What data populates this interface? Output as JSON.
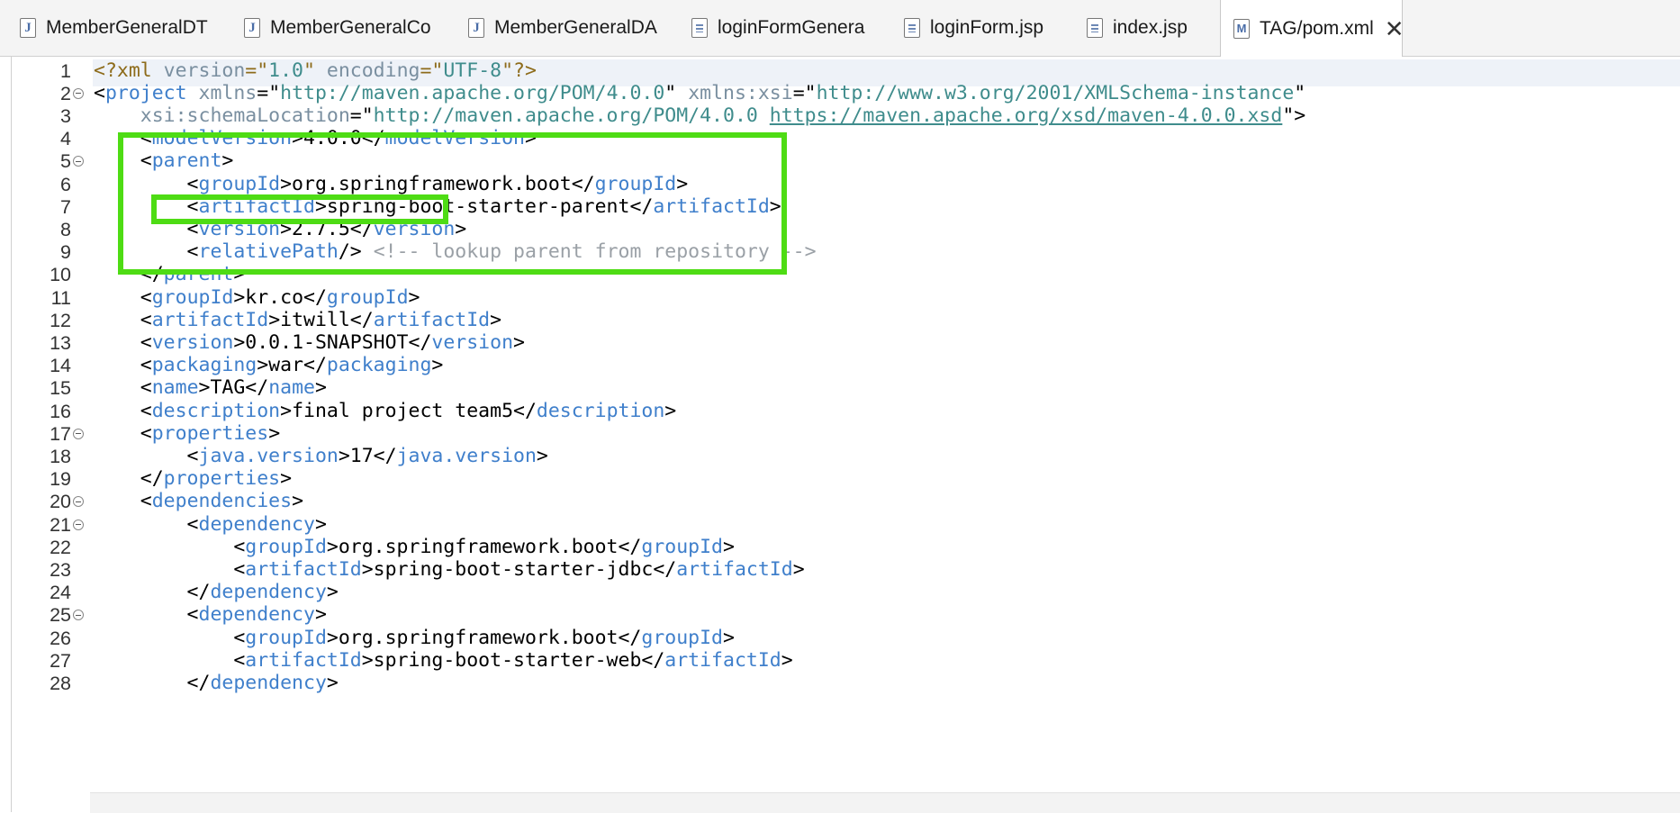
{
  "tabs": [
    {
      "label": "MemberGeneralDT",
      "icon": "java-file-icon"
    },
    {
      "label": "MemberGeneralCo",
      "icon": "java-file-icon"
    },
    {
      "label": "MemberGeneralDA",
      "icon": "java-file-icon"
    },
    {
      "label": "loginFormGenera",
      "icon": "jsp-file-icon"
    },
    {
      "label": "loginForm.jsp",
      "icon": "jsp-file-icon"
    },
    {
      "label": "index.jsp",
      "icon": "jsp-file-icon"
    },
    {
      "label": "TAG/pom.xml",
      "icon": "maven-xml-icon",
      "active": true
    }
  ],
  "editor": {
    "lines": [
      {
        "n": "1",
        "fold": false,
        "parts": [
          [
            "pi",
            "<?xml "
          ],
          [
            "attr",
            "version"
          ],
          [
            "pi",
            "=\""
          ],
          [
            "str",
            "1.0"
          ],
          [
            "pi",
            "\" "
          ],
          [
            "attr",
            "encoding"
          ],
          [
            "pi",
            "=\""
          ],
          [
            "str",
            "UTF-8"
          ],
          [
            "pi",
            "\"?>"
          ]
        ]
      },
      {
        "n": "2",
        "fold": true,
        "parts": [
          [
            "",
            "<"
          ],
          [
            "tag",
            "project"
          ],
          [
            "",
            " "
          ],
          [
            "attr",
            "xmlns"
          ],
          [
            "",
            "=\""
          ],
          [
            "str",
            "http://maven.apache.org/POM/4.0.0"
          ],
          [
            "",
            "\" "
          ],
          [
            "attr",
            "xmlns:xsi"
          ],
          [
            "",
            "=\""
          ],
          [
            "str",
            "http://www.w3.org/2001/XMLSchema-instance"
          ],
          [
            "",
            "\""
          ]
        ]
      },
      {
        "n": "3",
        "fold": false,
        "parts": [
          [
            "",
            "    "
          ],
          [
            "attr",
            "xsi:schemaLocation"
          ],
          [
            "",
            "=\""
          ],
          [
            "str",
            "http://maven.apache.org/POM/4.0.0 "
          ],
          [
            "link",
            "https://maven.apache.org/xsd/maven-4.0.0.xsd"
          ],
          [
            "",
            "\">"
          ]
        ]
      },
      {
        "n": "4",
        "fold": false,
        "parts": [
          [
            "",
            "    <"
          ],
          [
            "tag",
            "modelVersion"
          ],
          [
            "",
            ">4.0.0</"
          ],
          [
            "tag",
            "modelVersion"
          ],
          [
            "",
            ">"
          ]
        ]
      },
      {
        "n": "5",
        "fold": true,
        "parts": [
          [
            "",
            "    <"
          ],
          [
            "tag",
            "parent"
          ],
          [
            "",
            ">"
          ]
        ]
      },
      {
        "n": "6",
        "fold": false,
        "parts": [
          [
            "",
            "        <"
          ],
          [
            "tag",
            "groupId"
          ],
          [
            "",
            ">org.springframework.boot</"
          ],
          [
            "tag",
            "groupId"
          ],
          [
            "",
            ">"
          ]
        ]
      },
      {
        "n": "7",
        "fold": false,
        "parts": [
          [
            "",
            "        <"
          ],
          [
            "tag",
            "artifactId"
          ],
          [
            "",
            ">spring-boot-starter-parent</"
          ],
          [
            "tag",
            "artifactId"
          ],
          [
            "",
            ">"
          ]
        ]
      },
      {
        "n": "8",
        "fold": false,
        "parts": [
          [
            "",
            "        <"
          ],
          [
            "tag",
            "version"
          ],
          [
            "",
            ">2.7.5</"
          ],
          [
            "tag",
            "version"
          ],
          [
            "",
            ">"
          ]
        ]
      },
      {
        "n": "9",
        "fold": false,
        "parts": [
          [
            "",
            "        <"
          ],
          [
            "tag",
            "relativePath"
          ],
          [
            "",
            "/> "
          ],
          [
            "cmt",
            "<!-- lookup parent from repository -->"
          ]
        ]
      },
      {
        "n": "10",
        "fold": false,
        "parts": [
          [
            "",
            "    </"
          ],
          [
            "tag",
            "parent"
          ],
          [
            "",
            ">"
          ]
        ]
      },
      {
        "n": "11",
        "fold": false,
        "parts": [
          [
            "",
            "    <"
          ],
          [
            "tag",
            "groupId"
          ],
          [
            "",
            ">kr.co</"
          ],
          [
            "tag",
            "groupId"
          ],
          [
            "",
            ">"
          ]
        ]
      },
      {
        "n": "12",
        "fold": false,
        "parts": [
          [
            "",
            "    <"
          ],
          [
            "tag",
            "artifactId"
          ],
          [
            "",
            ">itwill</"
          ],
          [
            "tag",
            "artifactId"
          ],
          [
            "",
            ">"
          ]
        ]
      },
      {
        "n": "13",
        "fold": false,
        "parts": [
          [
            "",
            "    <"
          ],
          [
            "tag",
            "version"
          ],
          [
            "",
            ">0.0.1-SNAPSHOT</"
          ],
          [
            "tag",
            "version"
          ],
          [
            "",
            ">"
          ]
        ]
      },
      {
        "n": "14",
        "fold": false,
        "parts": [
          [
            "",
            "    <"
          ],
          [
            "tag",
            "packaging"
          ],
          [
            "",
            ">war</"
          ],
          [
            "tag",
            "packaging"
          ],
          [
            "",
            ">"
          ]
        ]
      },
      {
        "n": "15",
        "fold": false,
        "parts": [
          [
            "",
            "    <"
          ],
          [
            "tag",
            "name"
          ],
          [
            "",
            ">TAG</"
          ],
          [
            "tag",
            "name"
          ],
          [
            "",
            ">"
          ]
        ]
      },
      {
        "n": "16",
        "fold": false,
        "parts": [
          [
            "",
            "    <"
          ],
          [
            "tag",
            "description"
          ],
          [
            "",
            ">final project team5</"
          ],
          [
            "tag",
            "description"
          ],
          [
            "",
            ">"
          ]
        ]
      },
      {
        "n": "17",
        "fold": true,
        "parts": [
          [
            "",
            "    <"
          ],
          [
            "tag",
            "properties"
          ],
          [
            "",
            ">"
          ]
        ]
      },
      {
        "n": "18",
        "fold": false,
        "parts": [
          [
            "",
            "        <"
          ],
          [
            "tag",
            "java.version"
          ],
          [
            "",
            ">17</"
          ],
          [
            "tag",
            "java.version"
          ],
          [
            "",
            ">"
          ]
        ]
      },
      {
        "n": "19",
        "fold": false,
        "parts": [
          [
            "",
            "    </"
          ],
          [
            "tag",
            "properties"
          ],
          [
            "",
            ">"
          ]
        ]
      },
      {
        "n": "20",
        "fold": true,
        "parts": [
          [
            "",
            "    <"
          ],
          [
            "tag",
            "dependencies"
          ],
          [
            "",
            ">"
          ]
        ]
      },
      {
        "n": "21",
        "fold": true,
        "parts": [
          [
            "",
            "        <"
          ],
          [
            "tag",
            "dependency"
          ],
          [
            "",
            ">"
          ]
        ]
      },
      {
        "n": "22",
        "fold": false,
        "parts": [
          [
            "",
            "            <"
          ],
          [
            "tag",
            "groupId"
          ],
          [
            "",
            ">org.springframework.boot</"
          ],
          [
            "tag",
            "groupId"
          ],
          [
            "",
            ">"
          ]
        ]
      },
      {
        "n": "23",
        "fold": false,
        "parts": [
          [
            "",
            "            <"
          ],
          [
            "tag",
            "artifactId"
          ],
          [
            "",
            ">spring-boot-starter-jdbc</"
          ],
          [
            "tag",
            "artifactId"
          ],
          [
            "",
            ">"
          ]
        ]
      },
      {
        "n": "24",
        "fold": false,
        "parts": [
          [
            "",
            "        </"
          ],
          [
            "tag",
            "dependency"
          ],
          [
            "",
            ">"
          ]
        ]
      },
      {
        "n": "25",
        "fold": true,
        "parts": [
          [
            "",
            "        <"
          ],
          [
            "tag",
            "dependency"
          ],
          [
            "",
            ">"
          ]
        ]
      },
      {
        "n": "26",
        "fold": false,
        "parts": [
          [
            "",
            "            <"
          ],
          [
            "tag",
            "groupId"
          ],
          [
            "",
            ">org.springframework.boot</"
          ],
          [
            "tag",
            "groupId"
          ],
          [
            "",
            ">"
          ]
        ]
      },
      {
        "n": "27",
        "fold": false,
        "parts": [
          [
            "",
            "            <"
          ],
          [
            "tag",
            "artifactId"
          ],
          [
            "",
            ">spring-boot-starter-web</"
          ],
          [
            "tag",
            "artifactId"
          ],
          [
            "",
            ">"
          ]
        ]
      },
      {
        "n": "28",
        "fold": false,
        "parts": [
          [
            "",
            "        </"
          ],
          [
            "tag",
            "dependency"
          ],
          [
            "",
            ">"
          ]
        ]
      }
    ]
  },
  "highlight_color": "#4edc14"
}
